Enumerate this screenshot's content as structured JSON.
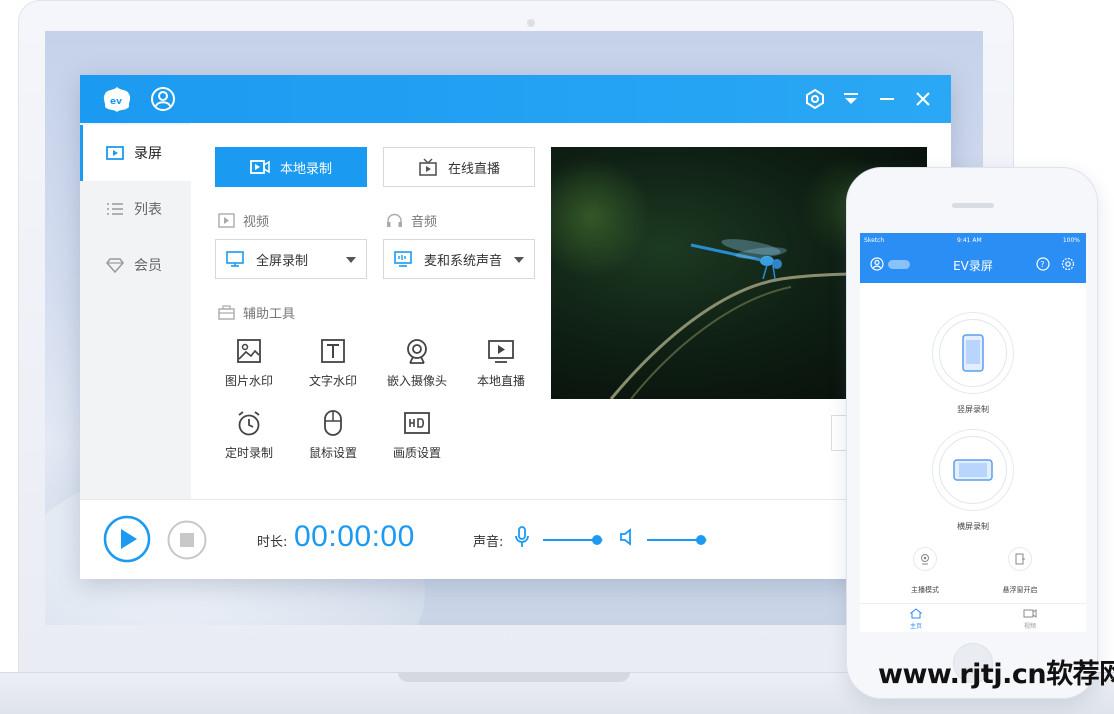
{
  "app": {
    "sidebar": [
      {
        "label": "录屏"
      },
      {
        "label": "列表"
      },
      {
        "label": "会员"
      }
    ],
    "modes": {
      "local": "本地录制",
      "live": "在线直播"
    },
    "video_section": "视频",
    "audio_section": "音频",
    "video_select": "全屏录制",
    "audio_select": "麦和系统声音",
    "tools_section": "辅助工具",
    "tools": [
      {
        "label": "图片水印",
        "icon": "image-icon"
      },
      {
        "label": "文字水印",
        "icon": "text-icon"
      },
      {
        "label": "嵌入摄像头",
        "icon": "webcam-icon"
      },
      {
        "label": "本地直播",
        "icon": "live-icon"
      },
      {
        "label": "定时录制",
        "icon": "alarm-icon"
      },
      {
        "label": "鼠标设置",
        "icon": "mouse-icon"
      },
      {
        "label": "画质设置",
        "icon": "hd-icon"
      }
    ],
    "duration_label": "时长:",
    "timer": "00:00:00",
    "sound_label": "声音:",
    "mic_level": 0.9,
    "speaker_level": 0.9,
    "accent_color": "#1b9af1"
  },
  "phone": {
    "status": {
      "carrier": "Sketch",
      "time": "9:41 AM",
      "battery": "100%"
    },
    "title": "EV录屏",
    "portrait_label": "竖屏录制",
    "landscape_label": "横屏录制",
    "anchor_label": "主播模式",
    "float_label": "悬浮窗开启",
    "tab_home": "主页",
    "tab_video": "视频",
    "accent_color": "#2b8ef5"
  },
  "watermark": "www.rjtj.cn软荐网"
}
